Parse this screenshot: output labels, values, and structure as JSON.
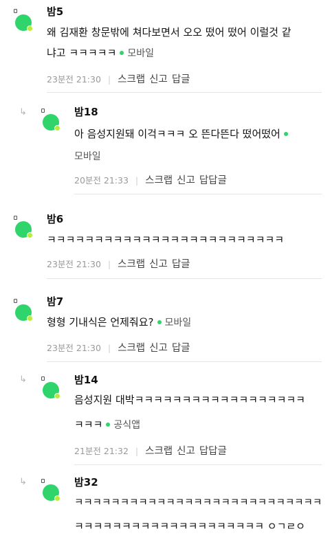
{
  "comments": [
    {
      "nick": "밤5",
      "line1": "왜 김재환 창문밖에 쳐다보면서 오오 떴어 떴어 이럴것 같",
      "line2": "냐고 ㅋㅋㅋㅋㅋ",
      "source": "모바일",
      "time": "23분전 21:30",
      "scrap": "스크랩",
      "report": "신고",
      "reply": "답글"
    },
    {
      "nick": "밤18",
      "line1": "아 음성지원돼 이걱ㅋㅋㅋ 오 뜬다뜬다 떴어떴어",
      "line2": "",
      "source": "모바일",
      "time": "20분전 21:33",
      "scrap": "스크랩",
      "report": "신고",
      "reply": "답답글"
    },
    {
      "nick": "밤6",
      "line1": "ㅋㅋㅋㅋㅋㅋㅋㅋㅋㅋㅋㅋㅋㅋㅋㅋㅋㅋㅋㅋㅋㅋㅋㅋㅋ",
      "time": "23분전 21:30",
      "scrap": "스크랩",
      "report": "신고",
      "reply": "답글"
    },
    {
      "nick": "밤7",
      "line1": "형형 기내식은 언제줘요?",
      "source": "모바일",
      "time": "23분전 21:30",
      "scrap": "스크랩",
      "report": "신고",
      "reply": "답글"
    },
    {
      "nick": "밤14",
      "line1": "음성지원 대박ㅋㅋㅋㅋㅋㅋㅋㅋㅋㅋㅋㅋㅋㅋㅋㅋㅋㅋ",
      "line2": "ㅋㅋㅋ",
      "source": "공식앱",
      "time": "21분전 21:32",
      "scrap": "스크랩",
      "report": "신고",
      "reply": "답답글"
    },
    {
      "nick": "밤32",
      "line1": "ㅋㅋㅋㅋㅋㅋㅋㅋㅋㅋㅋㅋㅋㅋㅋㅋㅋㅋㅋㅋㅋㅋㅋㅋㅋㅋㅋ",
      "line2": "ㅋㅋㅋㅋㅋㅋㅋㅋㅋㅋㅋㅋㅋㅋㅋㅋㅋㅋㅋㅋ ㅇㄱㄹㅇ"
    }
  ],
  "icons": {
    "reply_arrow": "reply-arrow-icon",
    "avatar": "avatar-icon",
    "source_dot": "source-dot-icon"
  },
  "colors": {
    "accent": "#2fd46a",
    "accent_light": "#b9ec3a"
  }
}
